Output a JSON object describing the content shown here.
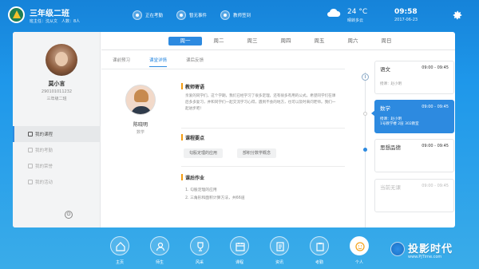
{
  "header": {
    "class_name": "三年级二班",
    "class_meta": "班主任：沈从文　人数：8人",
    "status_items": [
      {
        "label": "正在考勤",
        "icon": "check-icon"
      },
      {
        "label": "暂无事件",
        "icon": "bell-icon"
      },
      {
        "label": "教师签到",
        "icon": "pen-icon"
      }
    ],
    "weather": {
      "temp": "24 °C",
      "desc": "晴转多云",
      "icon": "cloud-icon"
    },
    "time": "09:58",
    "date": "2017-06-23",
    "settings_icon": "gear-icon"
  },
  "profile": {
    "name": "莫小言",
    "id": "290101011232",
    "class": "三年级二班"
  },
  "sidebar": {
    "items": [
      {
        "label": "我的课程",
        "icon": "book-icon",
        "active": true
      },
      {
        "label": "我的考勤",
        "icon": "calendar-icon",
        "active": false
      },
      {
        "label": "我的荣誉",
        "icon": "medal-icon",
        "active": false
      },
      {
        "label": "我的活动",
        "icon": "flag-icon",
        "active": false
      }
    ],
    "logout_icon": "power-icon"
  },
  "week": {
    "days": [
      "周一",
      "周二",
      "周三",
      "周四",
      "周五",
      "周六",
      "周日"
    ],
    "active_index": 0
  },
  "subtabs": {
    "items": [
      "课前预习",
      "课堂详情",
      "课后反馈"
    ],
    "active_index": 1
  },
  "teacher": {
    "name": "陈晓明",
    "subject": "数学"
  },
  "sections": {
    "guide": {
      "title": "教师寄语",
      "body": "亲爱的同学们，这个学期，我们已经学习了很多定理，还有很多有用的公式。希望同学们在课后多多复习，并和同学们一起交流学习心得，遇到不会的地方，也可以及时来问老师。我们一起进步吧！"
    },
    "points": {
      "title": "课程要点",
      "pills": [
        "勾股定理的应用",
        "部积分数学概念"
      ]
    },
    "homework": {
      "title": "课后作业",
      "items": [
        "1. 勾股定理的应用",
        "2. 三角形和面积计算方法，共66道"
      ]
    }
  },
  "schedule": {
    "lessons": [
      {
        "name": "语文",
        "time": "09:00 - 09:45",
        "meta": "授课：赵小明",
        "state": "normal"
      },
      {
        "name": "数学",
        "time": "09:00 - 09:45",
        "meta": "授课：赵小明\n1号教学楼 2层 302教室",
        "state": "active"
      },
      {
        "name": "思想品德",
        "time": "09:00 - 09:45",
        "meta": "",
        "state": "normal"
      },
      {
        "name": "当前无课",
        "time": "09:00 - 09:45",
        "meta": "",
        "state": "dim"
      }
    ]
  },
  "dock": {
    "items": [
      {
        "label": "主页",
        "icon": "home-icon"
      },
      {
        "label": "师生",
        "icon": "people-icon"
      },
      {
        "label": "风采",
        "icon": "trophy-icon"
      },
      {
        "label": "课程",
        "icon": "calendar-icon"
      },
      {
        "label": "资讯",
        "icon": "document-icon"
      },
      {
        "label": "考勤",
        "icon": "clipboard-icon"
      },
      {
        "label": "个人",
        "icon": "smile-icon"
      }
    ],
    "active_index": 6
  },
  "watermark": {
    "text": "投影时代",
    "url": "www.PjTime.com"
  }
}
